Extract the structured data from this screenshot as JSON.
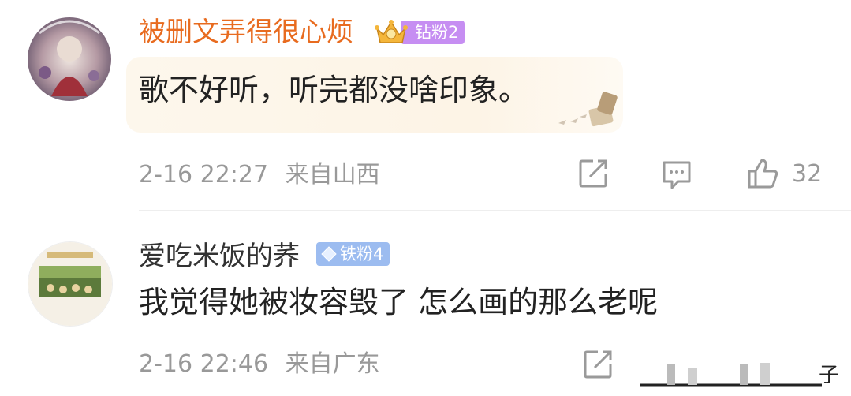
{
  "comments": [
    {
      "username": "被删文弄得很心烦",
      "badge": "钻粉2",
      "text": "歌不好听，听完都没啥印象。",
      "time": "2-16 22:27",
      "location": "来自山西",
      "likes": "32",
      "name_color": "#e86b1f",
      "badge_color": "#c68ef2"
    },
    {
      "username": "爱吃米饭的荞",
      "badge": "铁粉4",
      "text": "我觉得她被妆容毁了  怎么画的那么老呢",
      "time": "2-16 22:46",
      "location": "来自广东",
      "truncated_text": "子",
      "name_color": "#333333",
      "badge_color": "#9cbcf0"
    }
  ],
  "icons": [
    "share-icon",
    "comment-icon",
    "like-icon",
    "crown-icon",
    "diamond-icon"
  ]
}
